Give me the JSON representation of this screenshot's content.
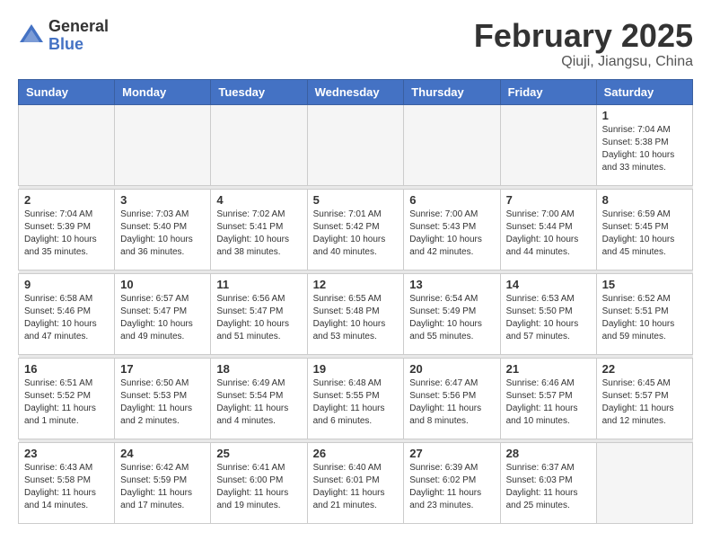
{
  "header": {
    "logo": {
      "general": "General",
      "blue": "Blue"
    },
    "title": "February 2025",
    "location": "Qiuji, Jiangsu, China"
  },
  "weekdays": [
    "Sunday",
    "Monday",
    "Tuesday",
    "Wednesday",
    "Thursday",
    "Friday",
    "Saturday"
  ],
  "weeks": [
    [
      {
        "day": "",
        "empty": true
      },
      {
        "day": "",
        "empty": true
      },
      {
        "day": "",
        "empty": true
      },
      {
        "day": "",
        "empty": true
      },
      {
        "day": "",
        "empty": true
      },
      {
        "day": "",
        "empty": true
      },
      {
        "day": "1",
        "sunrise": "7:04 AM",
        "sunset": "5:38 PM",
        "daylight": "10 hours and 33 minutes."
      }
    ],
    [
      {
        "day": "2",
        "sunrise": "7:04 AM",
        "sunset": "5:39 PM",
        "daylight": "10 hours and 35 minutes."
      },
      {
        "day": "3",
        "sunrise": "7:03 AM",
        "sunset": "5:40 PM",
        "daylight": "10 hours and 36 minutes."
      },
      {
        "day": "4",
        "sunrise": "7:02 AM",
        "sunset": "5:41 PM",
        "daylight": "10 hours and 38 minutes."
      },
      {
        "day": "5",
        "sunrise": "7:01 AM",
        "sunset": "5:42 PM",
        "daylight": "10 hours and 40 minutes."
      },
      {
        "day": "6",
        "sunrise": "7:00 AM",
        "sunset": "5:43 PM",
        "daylight": "10 hours and 42 minutes."
      },
      {
        "day": "7",
        "sunrise": "7:00 AM",
        "sunset": "5:44 PM",
        "daylight": "10 hours and 44 minutes."
      },
      {
        "day": "8",
        "sunrise": "6:59 AM",
        "sunset": "5:45 PM",
        "daylight": "10 hours and 45 minutes."
      }
    ],
    [
      {
        "day": "9",
        "sunrise": "6:58 AM",
        "sunset": "5:46 PM",
        "daylight": "10 hours and 47 minutes."
      },
      {
        "day": "10",
        "sunrise": "6:57 AM",
        "sunset": "5:47 PM",
        "daylight": "10 hours and 49 minutes."
      },
      {
        "day": "11",
        "sunrise": "6:56 AM",
        "sunset": "5:47 PM",
        "daylight": "10 hours and 51 minutes."
      },
      {
        "day": "12",
        "sunrise": "6:55 AM",
        "sunset": "5:48 PM",
        "daylight": "10 hours and 53 minutes."
      },
      {
        "day": "13",
        "sunrise": "6:54 AM",
        "sunset": "5:49 PM",
        "daylight": "10 hours and 55 minutes."
      },
      {
        "day": "14",
        "sunrise": "6:53 AM",
        "sunset": "5:50 PM",
        "daylight": "10 hours and 57 minutes."
      },
      {
        "day": "15",
        "sunrise": "6:52 AM",
        "sunset": "5:51 PM",
        "daylight": "10 hours and 59 minutes."
      }
    ],
    [
      {
        "day": "16",
        "sunrise": "6:51 AM",
        "sunset": "5:52 PM",
        "daylight": "11 hours and 1 minute."
      },
      {
        "day": "17",
        "sunrise": "6:50 AM",
        "sunset": "5:53 PM",
        "daylight": "11 hours and 2 minutes."
      },
      {
        "day": "18",
        "sunrise": "6:49 AM",
        "sunset": "5:54 PM",
        "daylight": "11 hours and 4 minutes."
      },
      {
        "day": "19",
        "sunrise": "6:48 AM",
        "sunset": "5:55 PM",
        "daylight": "11 hours and 6 minutes."
      },
      {
        "day": "20",
        "sunrise": "6:47 AM",
        "sunset": "5:56 PM",
        "daylight": "11 hours and 8 minutes."
      },
      {
        "day": "21",
        "sunrise": "6:46 AM",
        "sunset": "5:57 PM",
        "daylight": "11 hours and 10 minutes."
      },
      {
        "day": "22",
        "sunrise": "6:45 AM",
        "sunset": "5:57 PM",
        "daylight": "11 hours and 12 minutes."
      }
    ],
    [
      {
        "day": "23",
        "sunrise": "6:43 AM",
        "sunset": "5:58 PM",
        "daylight": "11 hours and 14 minutes."
      },
      {
        "day": "24",
        "sunrise": "6:42 AM",
        "sunset": "5:59 PM",
        "daylight": "11 hours and 17 minutes."
      },
      {
        "day": "25",
        "sunrise": "6:41 AM",
        "sunset": "6:00 PM",
        "daylight": "11 hours and 19 minutes."
      },
      {
        "day": "26",
        "sunrise": "6:40 AM",
        "sunset": "6:01 PM",
        "daylight": "11 hours and 21 minutes."
      },
      {
        "day": "27",
        "sunrise": "6:39 AM",
        "sunset": "6:02 PM",
        "daylight": "11 hours and 23 minutes."
      },
      {
        "day": "28",
        "sunrise": "6:37 AM",
        "sunset": "6:03 PM",
        "daylight": "11 hours and 25 minutes."
      },
      {
        "day": "",
        "empty": true
      }
    ]
  ],
  "labels": {
    "sunrise": "Sunrise:",
    "sunset": "Sunset:",
    "daylight": "Daylight:"
  }
}
